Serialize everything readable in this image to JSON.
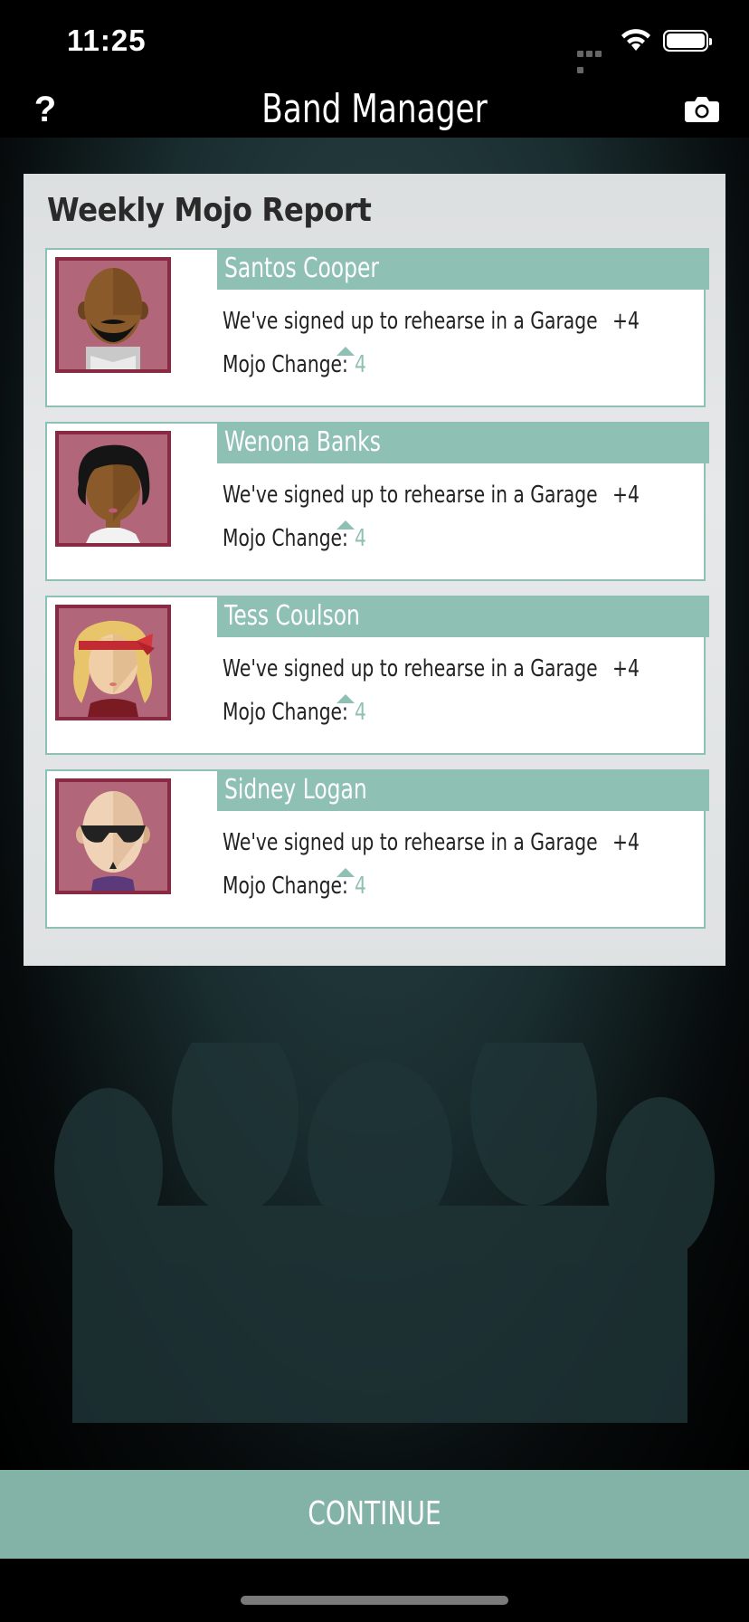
{
  "status": {
    "time": "11:25"
  },
  "nav": {
    "help_label": "?",
    "title": "Band Manager",
    "camera_icon": "camera-icon"
  },
  "report": {
    "title": "Weekly Mojo Report",
    "members": [
      {
        "name": "Santos Cooper",
        "event": "We've signed up to rehearse in a Garage",
        "event_delta": "+4",
        "mojo_label": "Mojo Change:",
        "mojo_value": "4"
      },
      {
        "name": "Wenona Banks",
        "event": "We've signed up to rehearse in a Garage",
        "event_delta": "+4",
        "mojo_label": "Mojo Change:",
        "mojo_value": "4"
      },
      {
        "name": "Tess Coulson",
        "event": "We've signed up to rehearse in a Garage",
        "event_delta": "+4",
        "mojo_label": "Mojo Change:",
        "mojo_value": "4"
      },
      {
        "name": "Sidney Logan",
        "event": "We've signed up to rehearse in a Garage",
        "event_delta": "+4",
        "mojo_label": "Mojo Change:",
        "mojo_value": "4"
      }
    ]
  },
  "footer": {
    "continue_label": "CONTINUE"
  },
  "colors": {
    "accent": "#8fc0b4",
    "button": "#82b3a6",
    "avatar_bg": "#b2667a",
    "avatar_border": "#8a2943"
  }
}
